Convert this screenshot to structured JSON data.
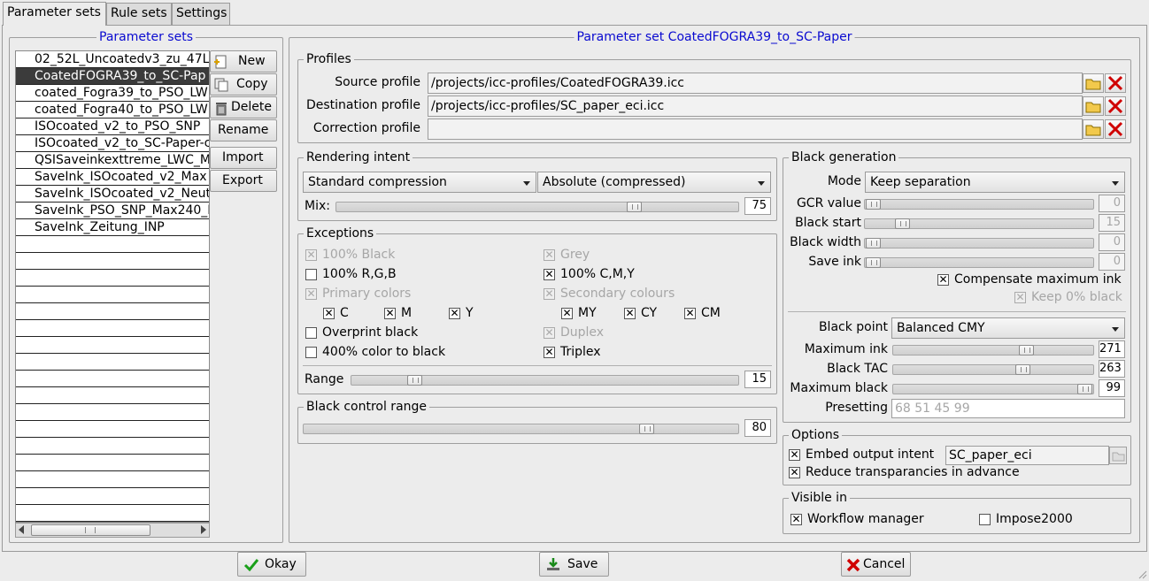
{
  "tabs": [
    "Parameter sets",
    "Rule sets",
    "Settings"
  ],
  "left": {
    "title": "Parameter sets",
    "items": [
      "02_52L_Uncoatedv3_zu_47L",
      "CoatedFOGRA39_to_SC-Pap",
      "coated_Fogra39_to_PSO_LW",
      "coated_Fogra40_to_PSO_LW",
      "ISOcoated_v2_to_PSO_SNP",
      "ISOcoated_v2_to_SC-Paper-c",
      "QSISaveinkexttreme_LWC_M",
      "SaveInk_ISOcoated_v2_Max",
      "SaveInk_ISOcoated_v2_Neut",
      "SaveInk_PSO_SNP_Max240_I",
      "SaveInk_Zeitung_INP"
    ],
    "buttons": {
      "new": "New",
      "copy": "Copy",
      "delete": "Delete",
      "rename": "Rename",
      "import": "Import",
      "export": "Export"
    }
  },
  "right": {
    "title": "Parameter set CoatedFOGRA39_to_SC-Paper",
    "profiles": {
      "title": "Profiles",
      "source_label": "Source profile",
      "source_value": "/projects/icc-profiles/CoatedFOGRA39.icc",
      "dest_label": "Destination profile",
      "dest_value": "/projects/icc-profiles/SC_paper_eci.icc",
      "corr_label": "Correction profile",
      "corr_value": ""
    },
    "rendering": {
      "title": "Rendering intent",
      "combo1": "Standard compression",
      "combo2": "Absolute (compressed)",
      "mix_label": "Mix:",
      "mix_value": "75",
      "mix_fraction": 0.75
    },
    "exceptions": {
      "title": "Exceptions",
      "black100": "100% Black",
      "grey": "Grey",
      "rgb100": "100% R,G,B",
      "cmy100": "100% C,M,Y",
      "primary": "Primary colors",
      "secondary": "Secondary colours",
      "c": "C",
      "m": "M",
      "y": "Y",
      "my": "MY",
      "cy": "CY",
      "cm": "CM",
      "overprint": "Overprint black",
      "duplex": "Duplex",
      "color400": "400% color to black",
      "triplex": "Triplex",
      "range_label": "Range",
      "range_value": "15",
      "range_fraction": 0.15
    },
    "black_control": {
      "title": "Black control range",
      "value": "80",
      "fraction": 0.8
    },
    "black_gen": {
      "title": "Black generation",
      "mode_label": "Mode",
      "mode_value": "Keep separation",
      "gcr_label": "GCR value",
      "gcr_value": "0",
      "start_label": "Black start",
      "start_value": "15",
      "width_label": "Black width",
      "width_value": "0",
      "save_label": "Save ink",
      "save_value": "0",
      "compensate": "Compensate maximum ink",
      "keep0": "Keep 0% black",
      "point_label": "Black point",
      "point_value": "Balanced CMY",
      "maxink_label": "Maximum ink",
      "maxink_value": "271",
      "tac_label": "Black TAC",
      "tac_value": "263",
      "maxblack_label": "Maximum black",
      "maxblack_value": "99",
      "presetting_label": "Presetting",
      "presetting_value": "68 51 45 99"
    },
    "options": {
      "title": "Options",
      "embed": "Embed output intent",
      "embed_value": "SC_paper_eci",
      "reduce": "Reduce transparancies in advance"
    },
    "visible": {
      "title": "Visible in",
      "workflow": "Workflow manager",
      "impose": "Impose2000"
    }
  },
  "footer": {
    "okay": "Okay",
    "save": "Save",
    "cancel": "Cancel"
  }
}
